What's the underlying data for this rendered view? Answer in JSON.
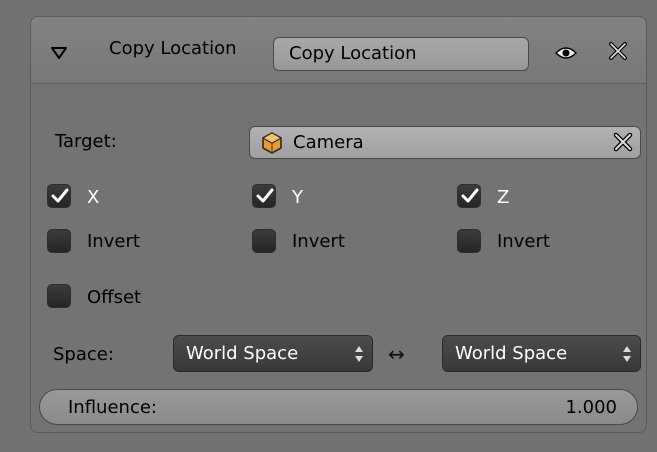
{
  "header": {
    "constraint_type": "Copy Location",
    "name_value": "Copy Location",
    "icons": [
      "disclosure-triangle-icon",
      "eye-icon",
      "close-icon"
    ]
  },
  "target": {
    "label": "Target:",
    "value": "Camera",
    "icons": [
      "camera-object-icon",
      "clear-icon"
    ]
  },
  "axes": [
    {
      "label": "X",
      "checked": true,
      "invert_label": "Invert",
      "invert_checked": false
    },
    {
      "label": "Y",
      "checked": true,
      "invert_label": "Invert",
      "invert_checked": false
    },
    {
      "label": "Z",
      "checked": true,
      "invert_label": "Invert",
      "invert_checked": false
    }
  ],
  "offset": {
    "label": "Offset",
    "checked": false
  },
  "space": {
    "label": "Space:",
    "target_space": "World Space",
    "owner_space": "World Space",
    "swap_symbol": "↔"
  },
  "influence": {
    "label": "Influence:",
    "value": "1.000"
  }
}
